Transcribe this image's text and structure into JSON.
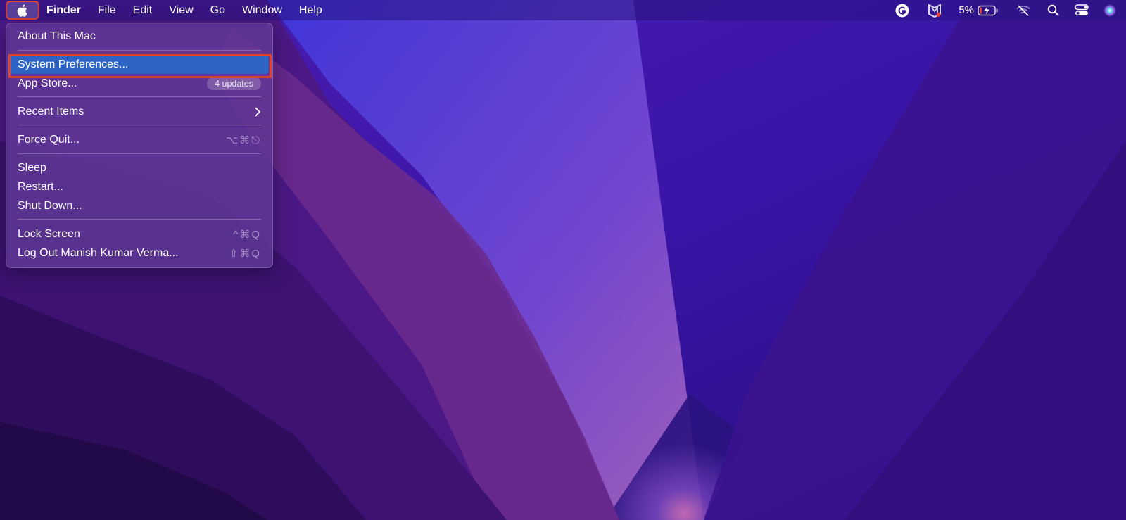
{
  "menubar": {
    "app_name": "Finder",
    "menus": [
      "File",
      "Edit",
      "View",
      "Go",
      "Window",
      "Help"
    ],
    "battery_percent": "5%"
  },
  "apple_menu": {
    "about": "About This Mac",
    "system_preferences": "System Preferences...",
    "app_store": "App Store...",
    "app_store_badge": "4 updates",
    "recent_items": "Recent Items",
    "force_quit": "Force Quit...",
    "force_quit_shortcut": "⌥⌘⎋",
    "sleep": "Sleep",
    "restart": "Restart...",
    "shut_down": "Shut Down...",
    "lock_screen": "Lock Screen",
    "lock_screen_shortcut": "^⌘Q",
    "log_out": "Log Out Manish Kumar Verma...",
    "log_out_shortcut": "⇧⌘Q"
  },
  "colors": {
    "highlight": "#2e63c6",
    "annotation": "#e2432f"
  },
  "icons": [
    "apple-logo-icon",
    "grammarly-icon",
    "mcafee-icon",
    "battery-charging-icon",
    "wifi-off-icon",
    "search-icon",
    "control-center-icon",
    "siri-icon",
    "chevron-right-icon"
  ]
}
